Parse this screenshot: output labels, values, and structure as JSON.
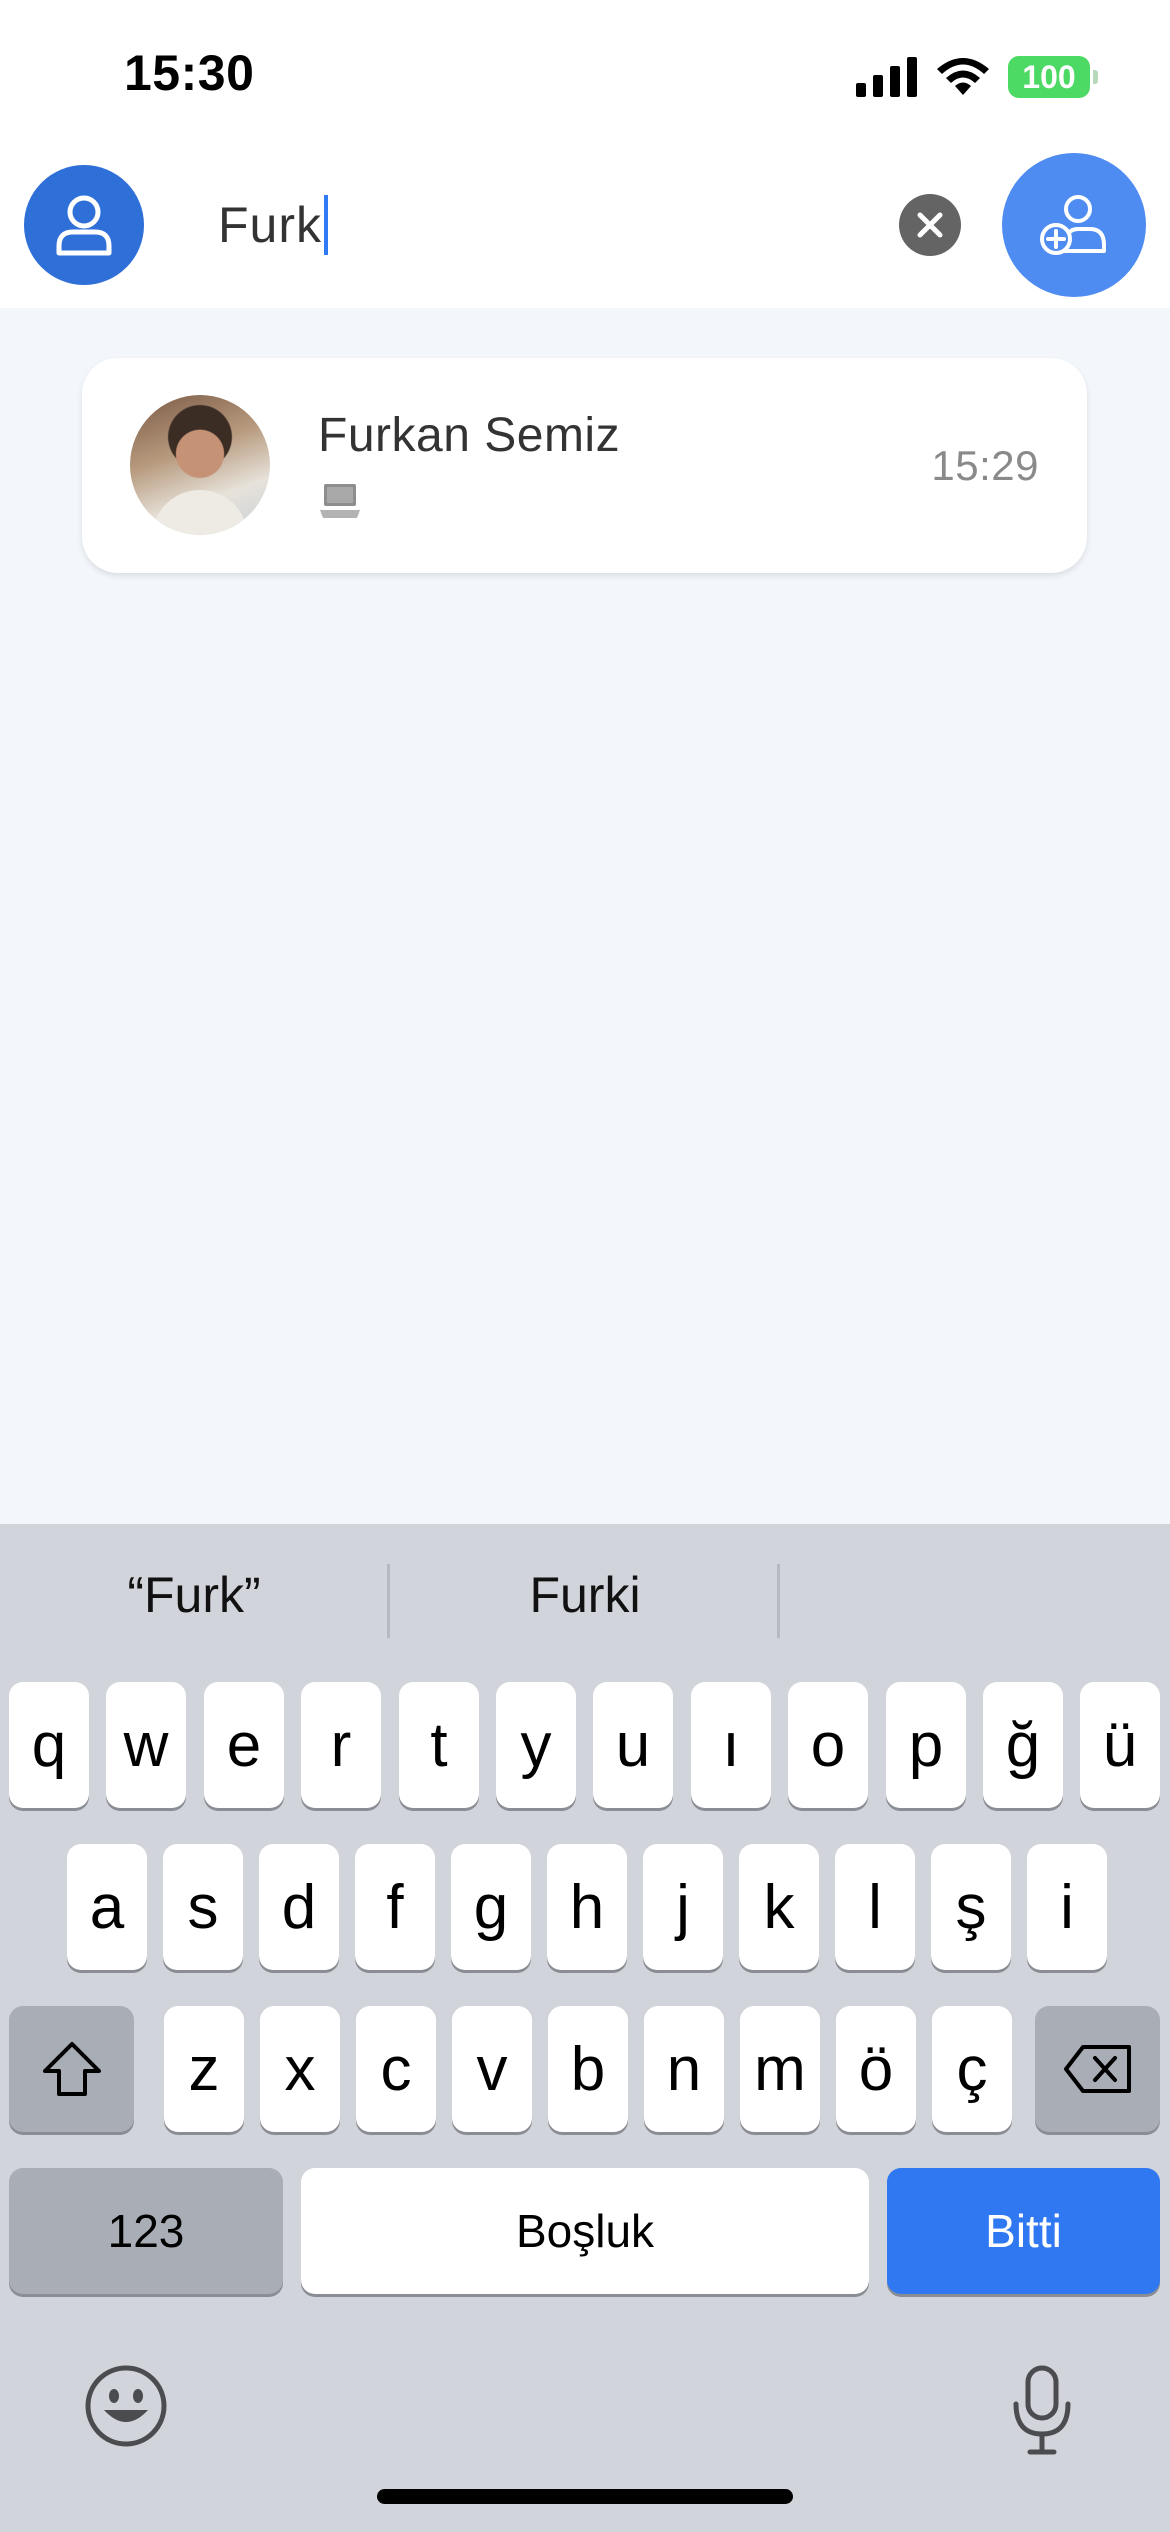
{
  "status_bar": {
    "time": "15:30",
    "battery": "100"
  },
  "search": {
    "query": "Furk",
    "clear_icon": "close-icon",
    "profile_icon": "person-icon",
    "add_contact_icon": "add-user-icon"
  },
  "results": [
    {
      "name": "Furkan Semiz",
      "time": "15:29",
      "preview_icon": "laptop-icon"
    }
  ],
  "keyboard": {
    "suggestions": [
      "“Furk”",
      "Furki"
    ],
    "row1": [
      "q",
      "w",
      "e",
      "r",
      "t",
      "y",
      "u",
      "ı",
      "o",
      "p",
      "ğ",
      "ü"
    ],
    "row2": [
      "a",
      "s",
      "d",
      "f",
      "g",
      "h",
      "j",
      "k",
      "l",
      "ş",
      "i"
    ],
    "row3": [
      "z",
      "x",
      "c",
      "v",
      "b",
      "n",
      "m",
      "ö",
      "ç"
    ],
    "numbers_label": "123",
    "space_label": "Boşluk",
    "done_label": "Bitti"
  },
  "colors": {
    "accent": "#2f6fd8",
    "add_button": "#4e8cf1",
    "done_key": "#2f78f2",
    "battery": "#4cd964"
  }
}
